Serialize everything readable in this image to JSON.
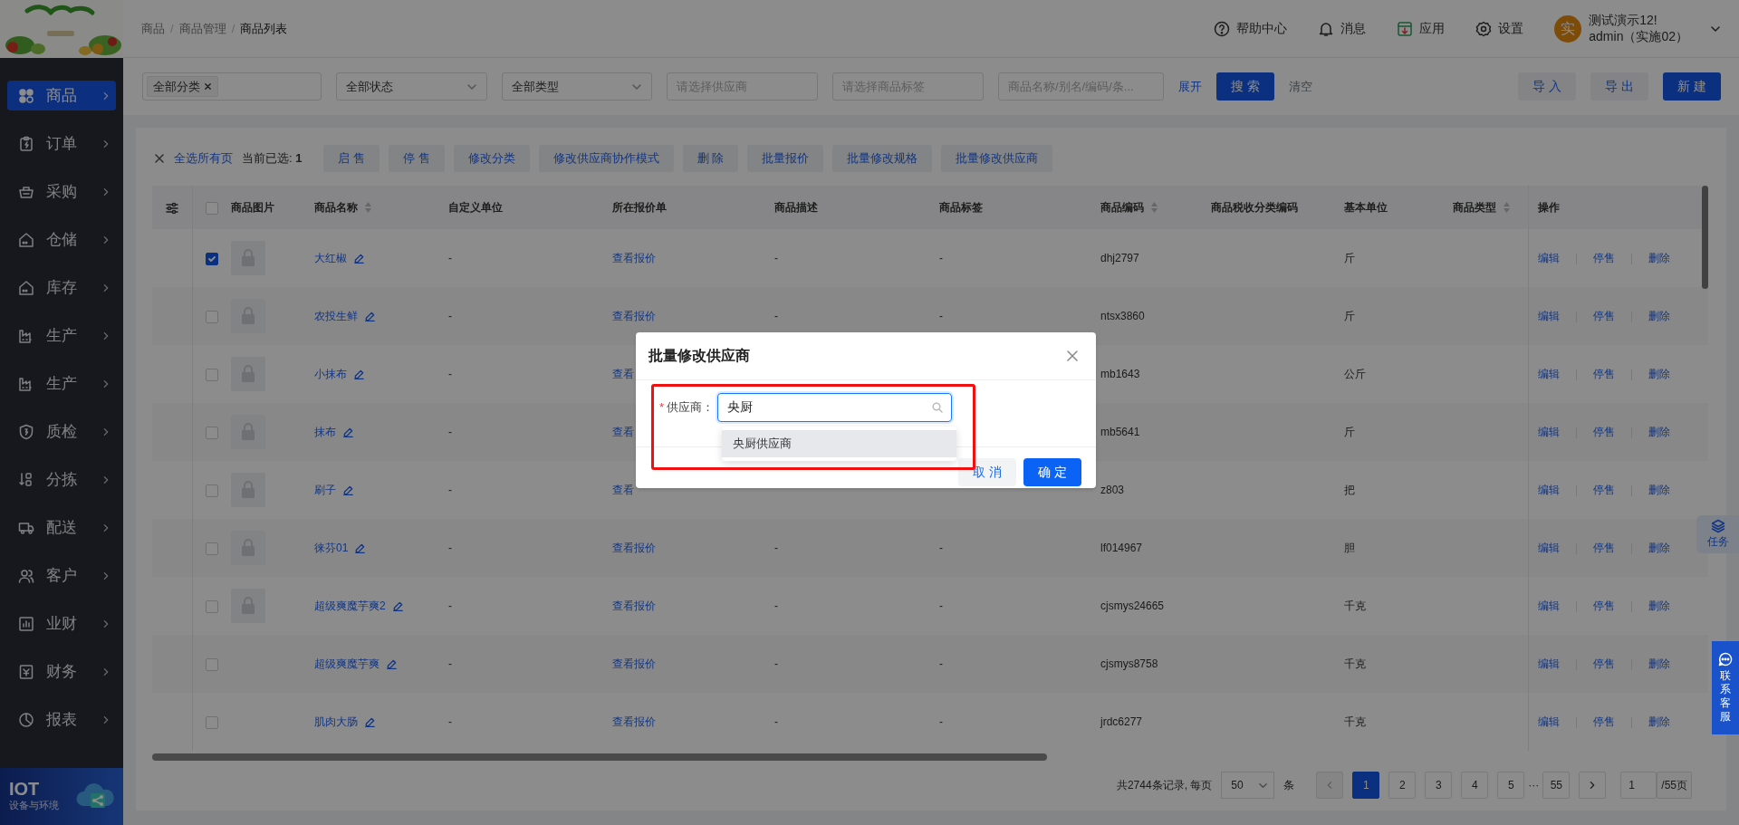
{
  "sidebar": {
    "items": [
      {
        "label": "商品",
        "selected": true
      },
      {
        "label": "订单",
        "selected": false
      },
      {
        "label": "采购",
        "selected": false
      },
      {
        "label": "仓储",
        "selected": false
      },
      {
        "label": "库存",
        "selected": false
      },
      {
        "label": "生产",
        "selected": false
      },
      {
        "label": "生产",
        "selected": false
      },
      {
        "label": "质检",
        "selected": false
      },
      {
        "label": "分拣",
        "selected": false
      },
      {
        "label": "配送",
        "selected": false
      },
      {
        "label": "客户",
        "selected": false
      },
      {
        "label": "业财",
        "selected": false
      },
      {
        "label": "财务",
        "selected": false
      },
      {
        "label": "报表",
        "selected": false
      }
    ],
    "banner": {
      "title": "IOT",
      "subtitle": "设备与环境"
    }
  },
  "breadcrumb": [
    "商品",
    "商品管理",
    "商品列表"
  ],
  "breadcrumb_separator": "/",
  "header_actions": [
    {
      "label": "帮助中心"
    },
    {
      "label": "消息"
    },
    {
      "label": "应用"
    },
    {
      "label": "设置"
    }
  ],
  "user": {
    "avatar": "实",
    "name": "测试演示12!",
    "account": "admin（实施02）"
  },
  "filters": [
    {
      "kind": "tags",
      "tags": [
        "全部分类"
      ]
    },
    {
      "kind": "select",
      "value": "全部状态"
    },
    {
      "kind": "select",
      "value": "全部类型"
    },
    {
      "kind": "input",
      "placeholder": "请选择供应商"
    },
    {
      "kind": "input",
      "placeholder": "请选择商品标签"
    },
    {
      "kind": "input",
      "placeholder": "商品名称/别名/编码/条..."
    }
  ],
  "filter_actions": {
    "expand": "展开",
    "search": "搜 索",
    "clear": "清空"
  },
  "page_actions": [
    {
      "label": "导 入",
      "primary": false
    },
    {
      "label": "导 出",
      "primary": false
    },
    {
      "label": "新 建",
      "primary": true
    }
  ],
  "batch_bar": {
    "select_all": "全选所有页",
    "selected_label": "当前已选:",
    "selected_count": "1",
    "actions": [
      "启 售",
      "停 售",
      "修改分类",
      "修改供应商协作模式",
      "删 除",
      "批量报价",
      "批量修改规格",
      "批量修改供应商"
    ]
  },
  "table": {
    "header_checked": false,
    "columns": [
      {
        "label": "商品图片",
        "sortable": false
      },
      {
        "label": "商品名称",
        "sortable": true
      },
      {
        "label": "自定义单位",
        "sortable": false
      },
      {
        "label": "所在报价单",
        "sortable": false
      },
      {
        "label": "商品描述",
        "sortable": false
      },
      {
        "label": "商品标签",
        "sortable": false
      },
      {
        "label": "商品编码",
        "sortable": true
      },
      {
        "label": "商品税收分类编码",
        "sortable": false
      },
      {
        "label": "基本单位",
        "sortable": false
      },
      {
        "label": "商品类型",
        "sortable": true
      },
      {
        "label": "操作",
        "sortable": false
      }
    ],
    "rows": [
      {
        "checked": true,
        "has_image": true,
        "name": "大红椒",
        "custom_unit": "-",
        "quote": "查看报价",
        "description": "-",
        "tags": "-",
        "code": "dhj2797",
        "base_unit": "斤",
        "actions": [
          "编辑",
          "停售",
          "删除"
        ]
      },
      {
        "checked": false,
        "has_image": true,
        "name": "农投生鲜",
        "custom_unit": "-",
        "quote": "查看报价",
        "description": "-",
        "tags": "-",
        "code": "ntsx3860",
        "base_unit": "斤",
        "actions": [
          "编辑",
          "停售",
          "删除"
        ]
      },
      {
        "checked": false,
        "has_image": true,
        "name": "小抹布",
        "custom_unit": "-",
        "quote": "查看",
        "code": "mb1643",
        "base_unit": "公斤",
        "actions": [
          "编辑",
          "停售",
          "删除"
        ]
      },
      {
        "checked": false,
        "has_image": true,
        "name": "抹布",
        "custom_unit": "-",
        "quote": "查看",
        "code": "mb5641",
        "base_unit": "斤",
        "actions": [
          "编辑",
          "停售",
          "删除"
        ]
      },
      {
        "checked": false,
        "has_image": true,
        "name": "刷子",
        "custom_unit": "-",
        "quote": "查看",
        "code": "z803",
        "base_unit": "把",
        "actions": [
          "编辑",
          "停售",
          "删除"
        ]
      },
      {
        "checked": false,
        "has_image": true,
        "name": "徕芬01",
        "custom_unit": "-",
        "quote": "查看报价",
        "description": "-",
        "tags": "-",
        "code": "lf014967",
        "base_unit": "胆",
        "actions": [
          "编辑",
          "停售",
          "删除"
        ]
      },
      {
        "checked": false,
        "has_image": true,
        "name": "超级爽魔芋爽2",
        "custom_unit": "-",
        "quote": "查看报价",
        "description": "-",
        "tags": "-",
        "code": "cjsmys24665",
        "base_unit": "千克",
        "actions": [
          "编辑",
          "停售",
          "删除"
        ]
      },
      {
        "checked": false,
        "has_image": false,
        "name": "超级爽魔芋爽",
        "custom_unit": "-",
        "quote": "查看报价",
        "description": "-",
        "tags": "-",
        "code": "cjsmys8758",
        "base_unit": "千克",
        "actions": [
          "编辑",
          "停售",
          "删除"
        ]
      },
      {
        "checked": false,
        "has_image": false,
        "name": "肌肉大肠",
        "custom_unit": "-",
        "quote": "查看报价",
        "description": "-",
        "tags": "-",
        "code": "jrdc6277",
        "base_unit": "千克",
        "actions": [
          "编辑",
          "停售",
          "删除"
        ]
      }
    ]
  },
  "pagination": {
    "total": "共2744条记录, 每页",
    "page_size": "50",
    "unit": "条",
    "pages": [
      {
        "kind": "page",
        "label": "1",
        "selected": true
      },
      {
        "kind": "page",
        "label": "2",
        "selected": false
      },
      {
        "kind": "page",
        "label": "3",
        "selected": false
      },
      {
        "kind": "page",
        "label": "4",
        "selected": false
      },
      {
        "kind": "page",
        "label": "5",
        "selected": false
      },
      {
        "kind": "ellipsis",
        "label": "···"
      },
      {
        "kind": "page",
        "label": "55",
        "selected": false
      }
    ],
    "jump_value": "1",
    "jump_suffix": "/55页"
  },
  "task_tab": {
    "label": "任务"
  },
  "support_tab": {
    "label": "联系客服"
  },
  "modal": {
    "title": "批量修改供应商",
    "field": {
      "label": "供应商：",
      "required_mark": "*",
      "value": "央厨",
      "highlighted": true
    },
    "options": [
      {
        "label": "央厨供应商",
        "selected": true
      }
    ],
    "buttons": [
      {
        "label": "取 消",
        "primary": false
      },
      {
        "label": "确 定",
        "primary": true
      }
    ]
  }
}
